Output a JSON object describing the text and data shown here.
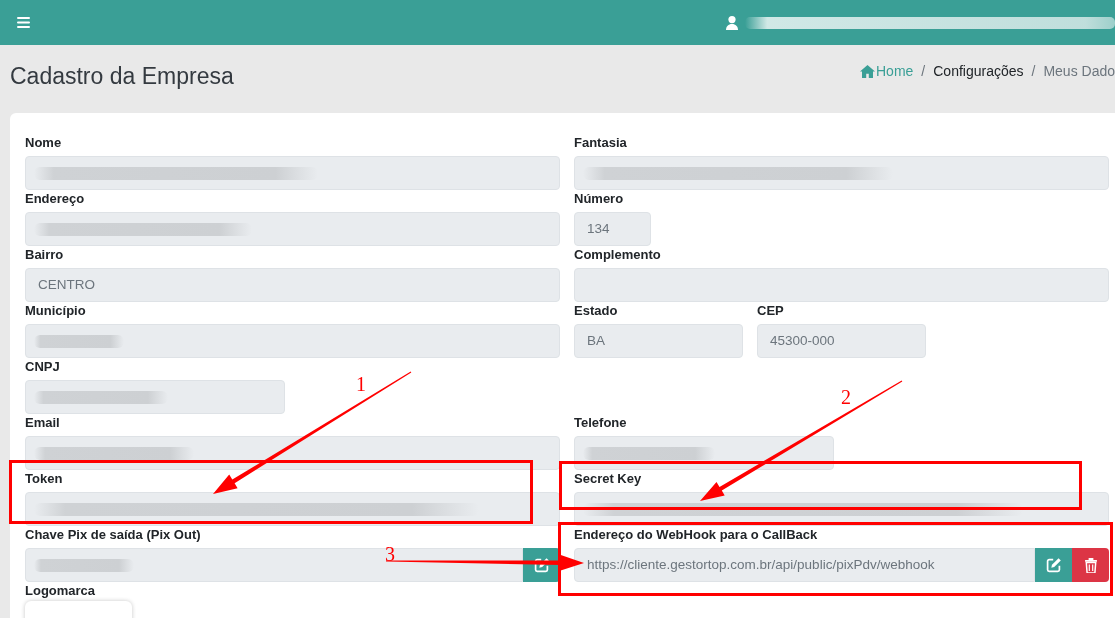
{
  "navbar": {
    "user": {
      "redacted": true
    }
  },
  "page": {
    "title": "Cadastro da Empresa",
    "breadcrumb": [
      {
        "kind": "home",
        "label": "Home"
      },
      {
        "kind": "link",
        "separator": "/",
        "label": "Configurações"
      },
      {
        "kind": "current",
        "separator": "/",
        "label": "Meus Dado"
      }
    ]
  },
  "form": {
    "rows": [
      {
        "left": [
          {
            "kind": "text",
            "label": "Nome",
            "redacted": true
          }
        ],
        "right": [
          {
            "kind": "text",
            "label": "Fantasia",
            "redacted": true
          }
        ]
      },
      {
        "left": [
          {
            "kind": "text",
            "label": "Endereço",
            "redacted": true
          }
        ],
        "right": [
          {
            "kind": "text",
            "label": "Número",
            "value": "134",
            "redacted": false
          }
        ]
      },
      {
        "left": [
          {
            "kind": "text",
            "label": "Bairro",
            "value": "CENTRO",
            "redacted": false
          }
        ],
        "right": [
          {
            "kind": "text",
            "label": "Complemento",
            "redacted": false
          }
        ]
      },
      {
        "left": [
          {
            "kind": "text",
            "label": "Município",
            "redacted": true
          }
        ],
        "right": [
          {
            "kind": "text",
            "label": "Estado",
            "value": "BA",
            "redacted": false
          },
          {
            "kind": "text",
            "label": "CEP",
            "value": "45300-000",
            "redacted": false
          }
        ]
      },
      {
        "left": [
          {
            "kind": "text",
            "label": "CNPJ",
            "redacted": true
          }
        ]
      },
      {
        "left": [
          {
            "kind": "text",
            "label": "Email",
            "redacted": true
          }
        ],
        "right": [
          {
            "kind": "text",
            "label": "Telefone",
            "redacted": true
          }
        ]
      },
      {
        "left": [
          {
            "kind": "text",
            "label": "Token",
            "redacted": true
          }
        ],
        "right": [
          {
            "kind": "text",
            "label": "Secret Key",
            "redacted": true
          }
        ]
      },
      {
        "left": [
          {
            "kind": "text_buttons",
            "label": "Chave Pix de saída (Pix Out)",
            "redacted": true,
            "buttons": [
              {
                "kind": "edit"
              }
            ]
          }
        ],
        "right": [
          {
            "kind": "text_buttons",
            "label": "Endereço do WebHook para o CallBack",
            "value": "https://cliente.gestortop.com.br/api/public/pixPdv/webhook",
            "redacted": false,
            "buttons": [
              {
                "kind": "edit"
              },
              {
                "kind": "delete"
              }
            ]
          }
        ]
      },
      {
        "left": [
          {
            "kind": "image",
            "label": "Logomarca"
          }
        ]
      }
    ]
  },
  "annotations": [
    {
      "label": "1"
    },
    {
      "label": "2"
    },
    {
      "label": "3"
    }
  ]
}
